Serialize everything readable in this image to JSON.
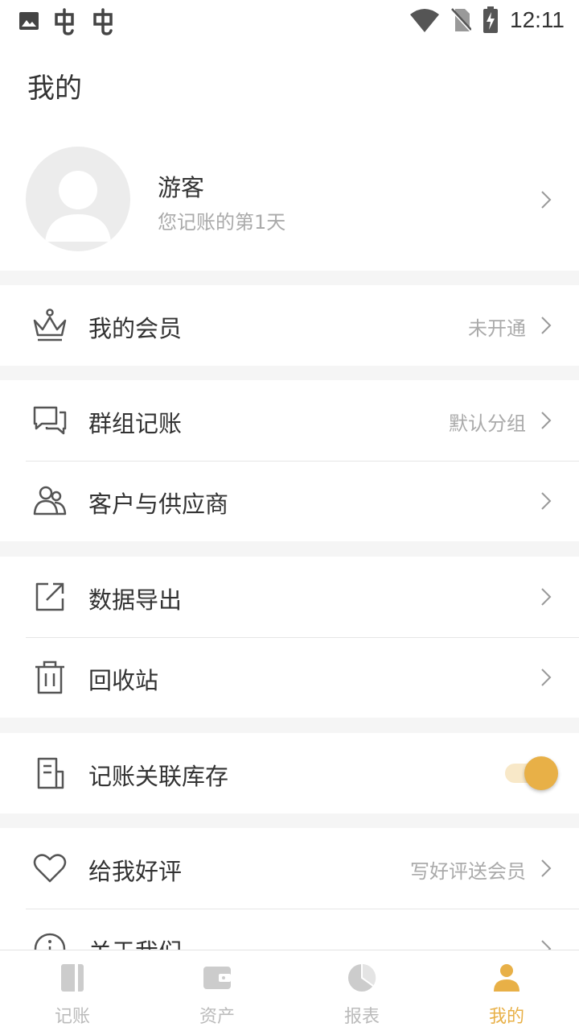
{
  "status_bar": {
    "time": "12:11",
    "icons": [
      "image-icon",
      "app-notification-icon",
      "app-notification-icon",
      "wifi-icon",
      "no-sim-icon",
      "battery-charging-icon"
    ]
  },
  "header": {
    "title": "我的"
  },
  "profile": {
    "name": "游客",
    "subtitle": "您记账的第1天"
  },
  "menu": {
    "membership": {
      "label": "我的会员",
      "value": "未开通",
      "icon": "crown-icon"
    },
    "group_accounting": {
      "label": "群组记账",
      "value": "默认分组",
      "icon": "chat-bubbles-icon"
    },
    "customers_suppliers": {
      "label": "客户与供应商",
      "icon": "users-icon"
    },
    "data_export": {
      "label": "数据导出",
      "icon": "export-icon"
    },
    "recycle_bin": {
      "label": "回收站",
      "icon": "trash-icon"
    },
    "inventory_link": {
      "label": "记账关联库存",
      "icon": "inventory-icon",
      "enabled": true
    },
    "rate_us": {
      "label": "给我好评",
      "value": "写好评送会员",
      "icon": "heart-icon"
    },
    "about_us": {
      "label": "关于我们",
      "icon": "info-icon"
    }
  },
  "tabs": [
    {
      "label": "记账",
      "icon": "book-icon",
      "active": false
    },
    {
      "label": "资产",
      "icon": "wallet-icon",
      "active": false
    },
    {
      "label": "报表",
      "icon": "pie-chart-icon",
      "active": false
    },
    {
      "label": "我的",
      "icon": "person-icon",
      "active": true
    }
  ],
  "colors": {
    "accent": "#e8b047",
    "text_primary": "#333333",
    "text_secondary": "#aaaaaa",
    "background": "#f5f5f5"
  }
}
